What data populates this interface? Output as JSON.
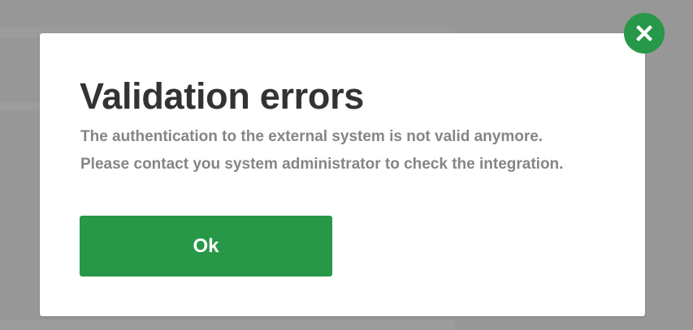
{
  "dialog": {
    "title": "Validation errors",
    "message_lines": [
      "The authentication to the external system is not valid anymore.",
      "Please contact you system administrator to check the integration."
    ],
    "ok_label": "Ok",
    "close_icon": "close-icon"
  },
  "colors": {
    "overlay": "#979797",
    "dialog_background": "#ffffff",
    "title": "#333333",
    "message": "#858585",
    "accent": "#279847"
  }
}
